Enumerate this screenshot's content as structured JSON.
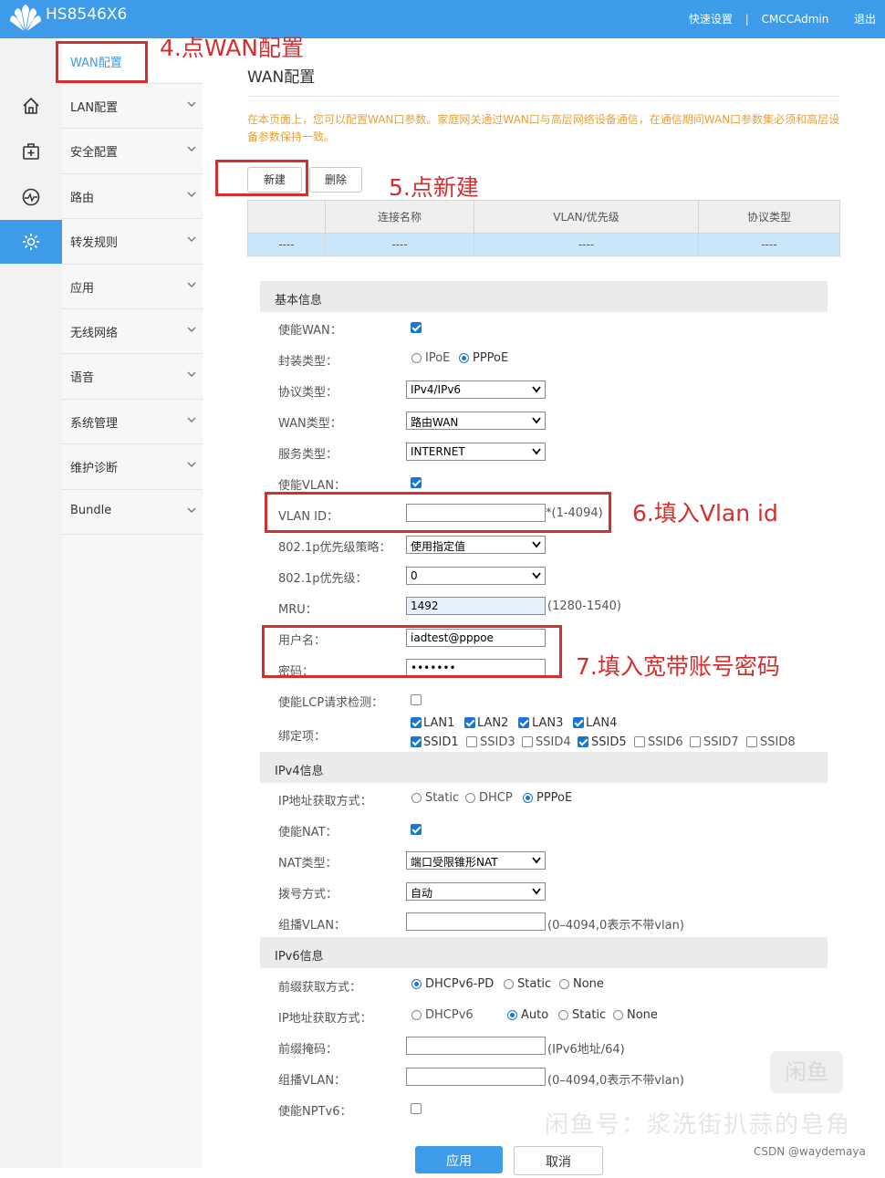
{
  "header": {
    "brand": "HS8546X6",
    "links": [
      "快速设置",
      "CMCCAdmin",
      "退出"
    ]
  },
  "rail_icons": [
    "home-icon",
    "first-aid-icon",
    "monitor-icon",
    "gear-icon"
  ],
  "sidebar": {
    "active_sub": "WAN配置",
    "items": [
      "LAN配置",
      "安全配置",
      "路由",
      "转发规则",
      "应用",
      "无线网络",
      "语音",
      "系统管理",
      "维护诊断",
      "Bundle"
    ]
  },
  "page": {
    "title": "WAN配置",
    "description": "在本页面上，您可以配置WAN口参数。家庭网关通过WAN口与高层网络设备通信，在通信期间WAN口参数集必须和高层设备参数保持一致。",
    "new_button": "新建",
    "delete_button": "删除"
  },
  "wan_table": {
    "headers": [
      "",
      "连接名称",
      "VLAN/优先级",
      "协议类型"
    ],
    "row": [
      "----",
      "----",
      "----",
      "----"
    ]
  },
  "sections": {
    "basic": "基本信息",
    "ipv4": "IPv4信息",
    "ipv6": "IPv6信息"
  },
  "basic": {
    "enable_wan": {
      "label": "使能WAN：",
      "checked": true
    },
    "encap": {
      "label": "封装类型：",
      "options": [
        "IPoE",
        "PPPoE"
      ],
      "selected": "PPPoE"
    },
    "protocol": {
      "label": "协议类型：",
      "value": "IPv4/IPv6"
    },
    "wan_type": {
      "label": "WAN类型：",
      "value": "路由WAN"
    },
    "service": {
      "label": "服务类型：",
      "value": "INTERNET"
    },
    "enable_vlan": {
      "label": "使能VLAN：",
      "checked": true
    },
    "vlan_id": {
      "label": "VLAN ID：",
      "value": "",
      "hint": "*(1-4094)"
    },
    "prio_policy": {
      "label": "802.1p优先级策略：",
      "value": "使用指定值"
    },
    "prio": {
      "label": "802.1p优先级：",
      "value": "0"
    },
    "mru": {
      "label": "MRU：",
      "value": "1492",
      "hint": "(1280-1540)"
    },
    "username": {
      "label": "用户名：",
      "value": "iadtest@pppoe"
    },
    "password": {
      "label": "密码：",
      "value": "•••••••"
    },
    "lcp": {
      "label": "使能LCP请求检测：",
      "checked": false
    },
    "binding": {
      "label": "绑定项：",
      "row1": [
        {
          "name": "LAN1",
          "checked": true
        },
        {
          "name": "LAN2",
          "checked": true
        },
        {
          "name": "LAN3",
          "checked": true
        },
        {
          "name": "LAN4",
          "checked": true
        }
      ],
      "row2": [
        {
          "name": "SSID1",
          "checked": true
        },
        {
          "name": "SSID3",
          "checked": false
        },
        {
          "name": "SSID4",
          "checked": false
        },
        {
          "name": "SSID5",
          "checked": true
        },
        {
          "name": "SSID6",
          "checked": false
        },
        {
          "name": "SSID7",
          "checked": false
        },
        {
          "name": "SSID8",
          "checked": false
        }
      ]
    }
  },
  "ipv4": {
    "ip_mode": {
      "label": "IP地址获取方式：",
      "options": [
        "Static",
        "DHCP",
        "PPPoE"
      ],
      "selected": "PPPoE"
    },
    "nat": {
      "label": "使能NAT：",
      "checked": true
    },
    "nat_type": {
      "label": "NAT类型：",
      "value": "端口受限锥形NAT"
    },
    "dial": {
      "label": "拨号方式：",
      "value": "自动"
    },
    "mcast_vlan": {
      "label": "组播VLAN：",
      "value": "",
      "hint": "(0–4094,0表示不带vlan)"
    }
  },
  "ipv6": {
    "prefix_mode": {
      "label": "前缀获取方式：",
      "options": [
        "DHCPv6-PD",
        "Static",
        "None"
      ],
      "selected": "DHCPv6-PD"
    },
    "ip_mode": {
      "label": "IP地址获取方式：",
      "options": [
        "DHCPv6",
        "Auto",
        "Static",
        "None"
      ],
      "selected": "Auto"
    },
    "prefix_mask": {
      "label": "前缀掩码：",
      "value": "",
      "hint": "(IPv6地址/64)"
    },
    "mcast_vlan": {
      "label": "组播VLAN：",
      "value": "",
      "hint": "(0–4094,0表示不带vlan)"
    },
    "nptv6": {
      "label": "使能NPTv6：",
      "checked": false
    }
  },
  "actions": {
    "apply": "应用",
    "cancel": "取消"
  },
  "annotations": {
    "step4": "4.点WAN配置",
    "step5": "5.点新建",
    "step6": "6.填入Vlan id",
    "step7": "7.填入宽带账号密码"
  },
  "watermark": {
    "text": "闲鱼号：浆洗街扒蒜的皂角",
    "logo": "闲鱼",
    "csdn": "CSDN @waydemaya"
  },
  "colors": {
    "accent": "#3d9bea",
    "annotation": "#d32f2f",
    "description": "#e8a13a",
    "table_row": "#c9e6fb"
  }
}
